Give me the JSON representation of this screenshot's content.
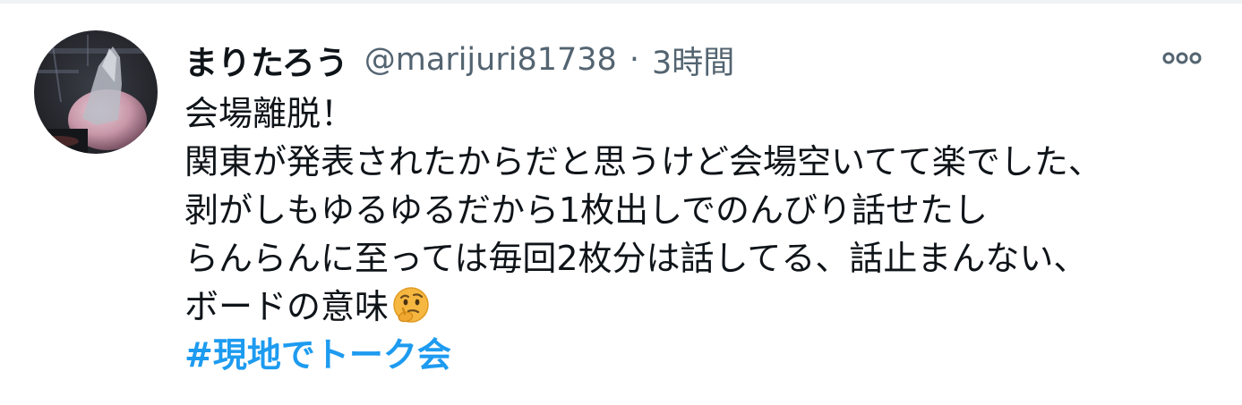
{
  "tweet": {
    "display_name": "まりたろう",
    "handle": "@marijuri81738",
    "separator": "·",
    "time": "3時間",
    "lines": [
      "会場離脱！",
      "関東が発表されたからだと思うけど会場空いてて楽でした、",
      "剥がしもゆるゆるだから1枚出しでのんびり話せたし",
      "らんらんに至っては毎回2枚分は話してる、話止まんない、",
      "ボードの意味"
    ],
    "emoji": "thinking-face-emoji",
    "hashtag": "#現地でトーク会"
  },
  "icons": {
    "more": "more-options-icon",
    "avatar": "profile-avatar"
  },
  "colors": {
    "text": "#0f1419",
    "secondary": "#536471",
    "link": "#1d9bf0"
  }
}
